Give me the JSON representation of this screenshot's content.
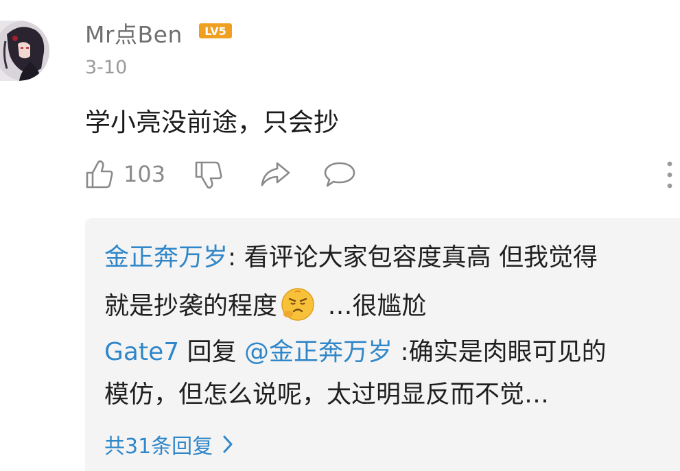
{
  "comment": {
    "username": "Mr点Ben",
    "level_badge": "LV5",
    "date": "3-10",
    "text": "学小亮没前途，只会抄",
    "like_count": "103"
  },
  "replies": [
    {
      "author": "金正奔万岁",
      "separator": ": ",
      "text_line1": "看评论大家包容度真高 但我觉得",
      "text_line2_before": "就是抄袭的程度",
      "emoji_icon": "frustrated-face-emoji",
      "text_line2_after": " …很尴尬"
    },
    {
      "author": "Gate7",
      "reply_word": " 回复 ",
      "mention": "@金正奔万岁",
      "text_line1": " :确实是肉眼可见的",
      "text_line2": "模仿，但怎么说呢，太过明显反而不觉…"
    }
  ],
  "view_all_label": "共31条回复",
  "colors": {
    "link_blue": "#2f86c8",
    "badge_orange": "#f0a020",
    "reply_bg": "#f4f4f4"
  }
}
